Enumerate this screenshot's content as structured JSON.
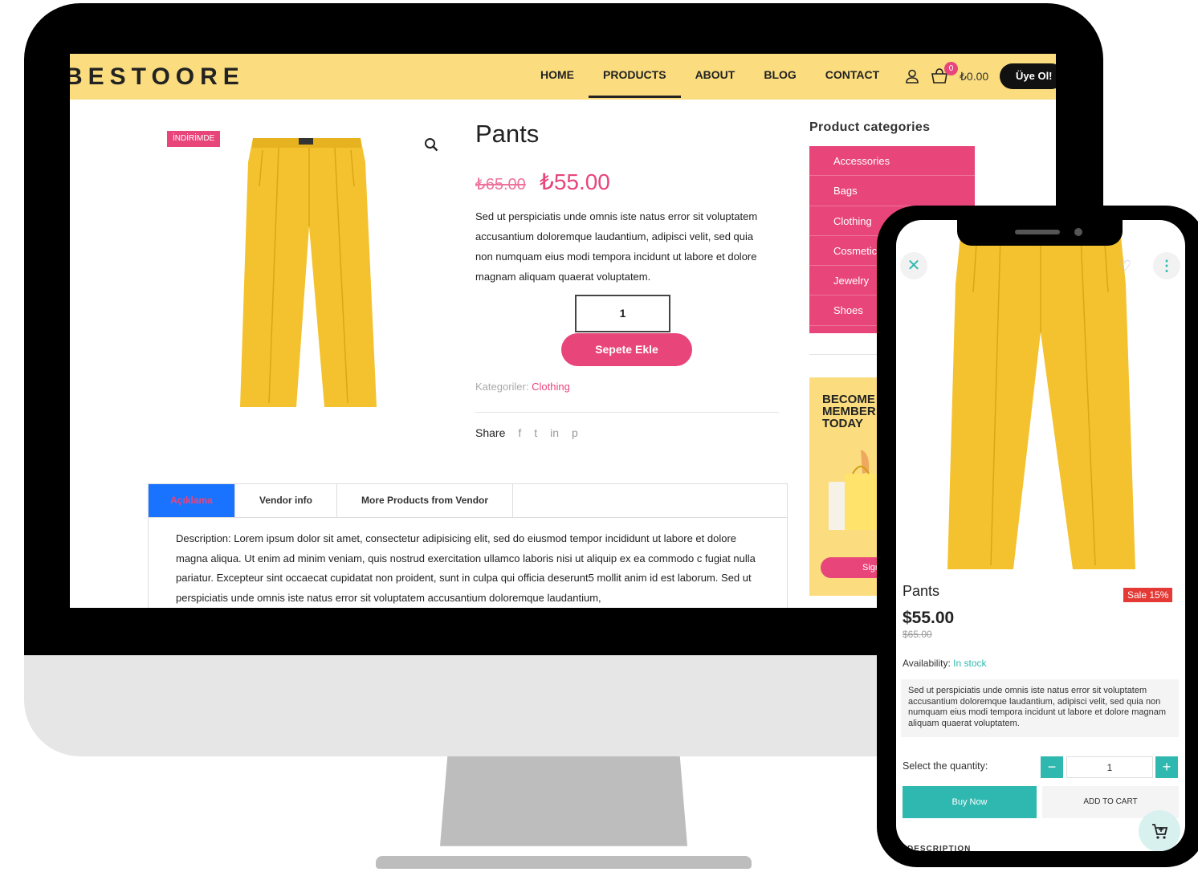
{
  "header": {
    "logo": "BESTOORE",
    "nav": [
      "HOME",
      "PRODUCTS",
      "ABOUT",
      "BLOG",
      "CONTACT"
    ],
    "active_nav": "PRODUCTS",
    "cart_count": "0",
    "cart_total": "₺0.00",
    "signup_label": "Üye Ol!"
  },
  "product": {
    "sale_badge": "İNDİRİMDE",
    "title": "Pants",
    "old_price": "₺65.00",
    "new_price": "₺55.00",
    "short_description": "Sed ut perspiciatis unde omnis iste natus error sit voluptatem accusantium doloremque laudantium, adipisci velit, sed quia non numquam eius modi tempora incidunt ut labore et dolore magnam aliquam quaerat voluptatem.",
    "quantity": "1",
    "add_to_cart": "Sepete Ekle",
    "categories_label": "Kategoriler:",
    "category": "Clothing",
    "share_label": "Share",
    "share_icons": [
      "f",
      "t",
      "in",
      "p"
    ]
  },
  "sidebar": {
    "title": "Product categories",
    "categories": [
      "Accessories",
      "Bags",
      "Clothing",
      "Cosmetics",
      "Jewelry",
      "Shoes"
    ],
    "promo_text": "BECOME A MEMBER TODAY",
    "promo_button": "Sign"
  },
  "tabs": {
    "items": [
      "Açıklama",
      "Vendor info",
      "More Products from Vendor"
    ],
    "description": "Description: Lorem ipsum dolor sit amet, consectetur adipisicing elit, sed do eiusmod tempor incididunt ut labore et dolore magna aliqua. Ut enim ad minim veniam, quis nostrud exercitation ullamco laboris nisi ut aliquip ex ea commodo c fugiat nulla pariatur. Excepteur sint occaecat cupidatat non proident, sunt in culpa qui officia deserunt5 mollit anim id est laborum. Sed ut perspiciatis unde omnis iste natus error sit voluptatem accusantium doloremque laudantium,"
  },
  "mobile": {
    "title": "Pants",
    "sale": "Sale 15%",
    "price": "$55.00",
    "old_price": "$65.00",
    "availability_label": "Availability:",
    "availability_value": "In stock",
    "description": "Sed ut perspiciatis unde omnis iste natus error sit voluptatem accusantium doloremque laudantium, adipisci velit, sed quia non numquam eius modi tempora incidunt ut labore et dolore magnam aliquam quaerat voluptatem.",
    "qty_label": "Select the quantity:",
    "qty_value": "1",
    "minus": "−",
    "plus": "+",
    "buy_now": "Buy Now",
    "add_to_cart": "ADD TO CART",
    "description_heading": "DESCRIPTION"
  },
  "colors": {
    "header_bg": "#fbdd7f",
    "accent_pink": "#e8457b",
    "accent_teal": "#2fb8b0",
    "pants_yellow": "#f4c22f"
  }
}
